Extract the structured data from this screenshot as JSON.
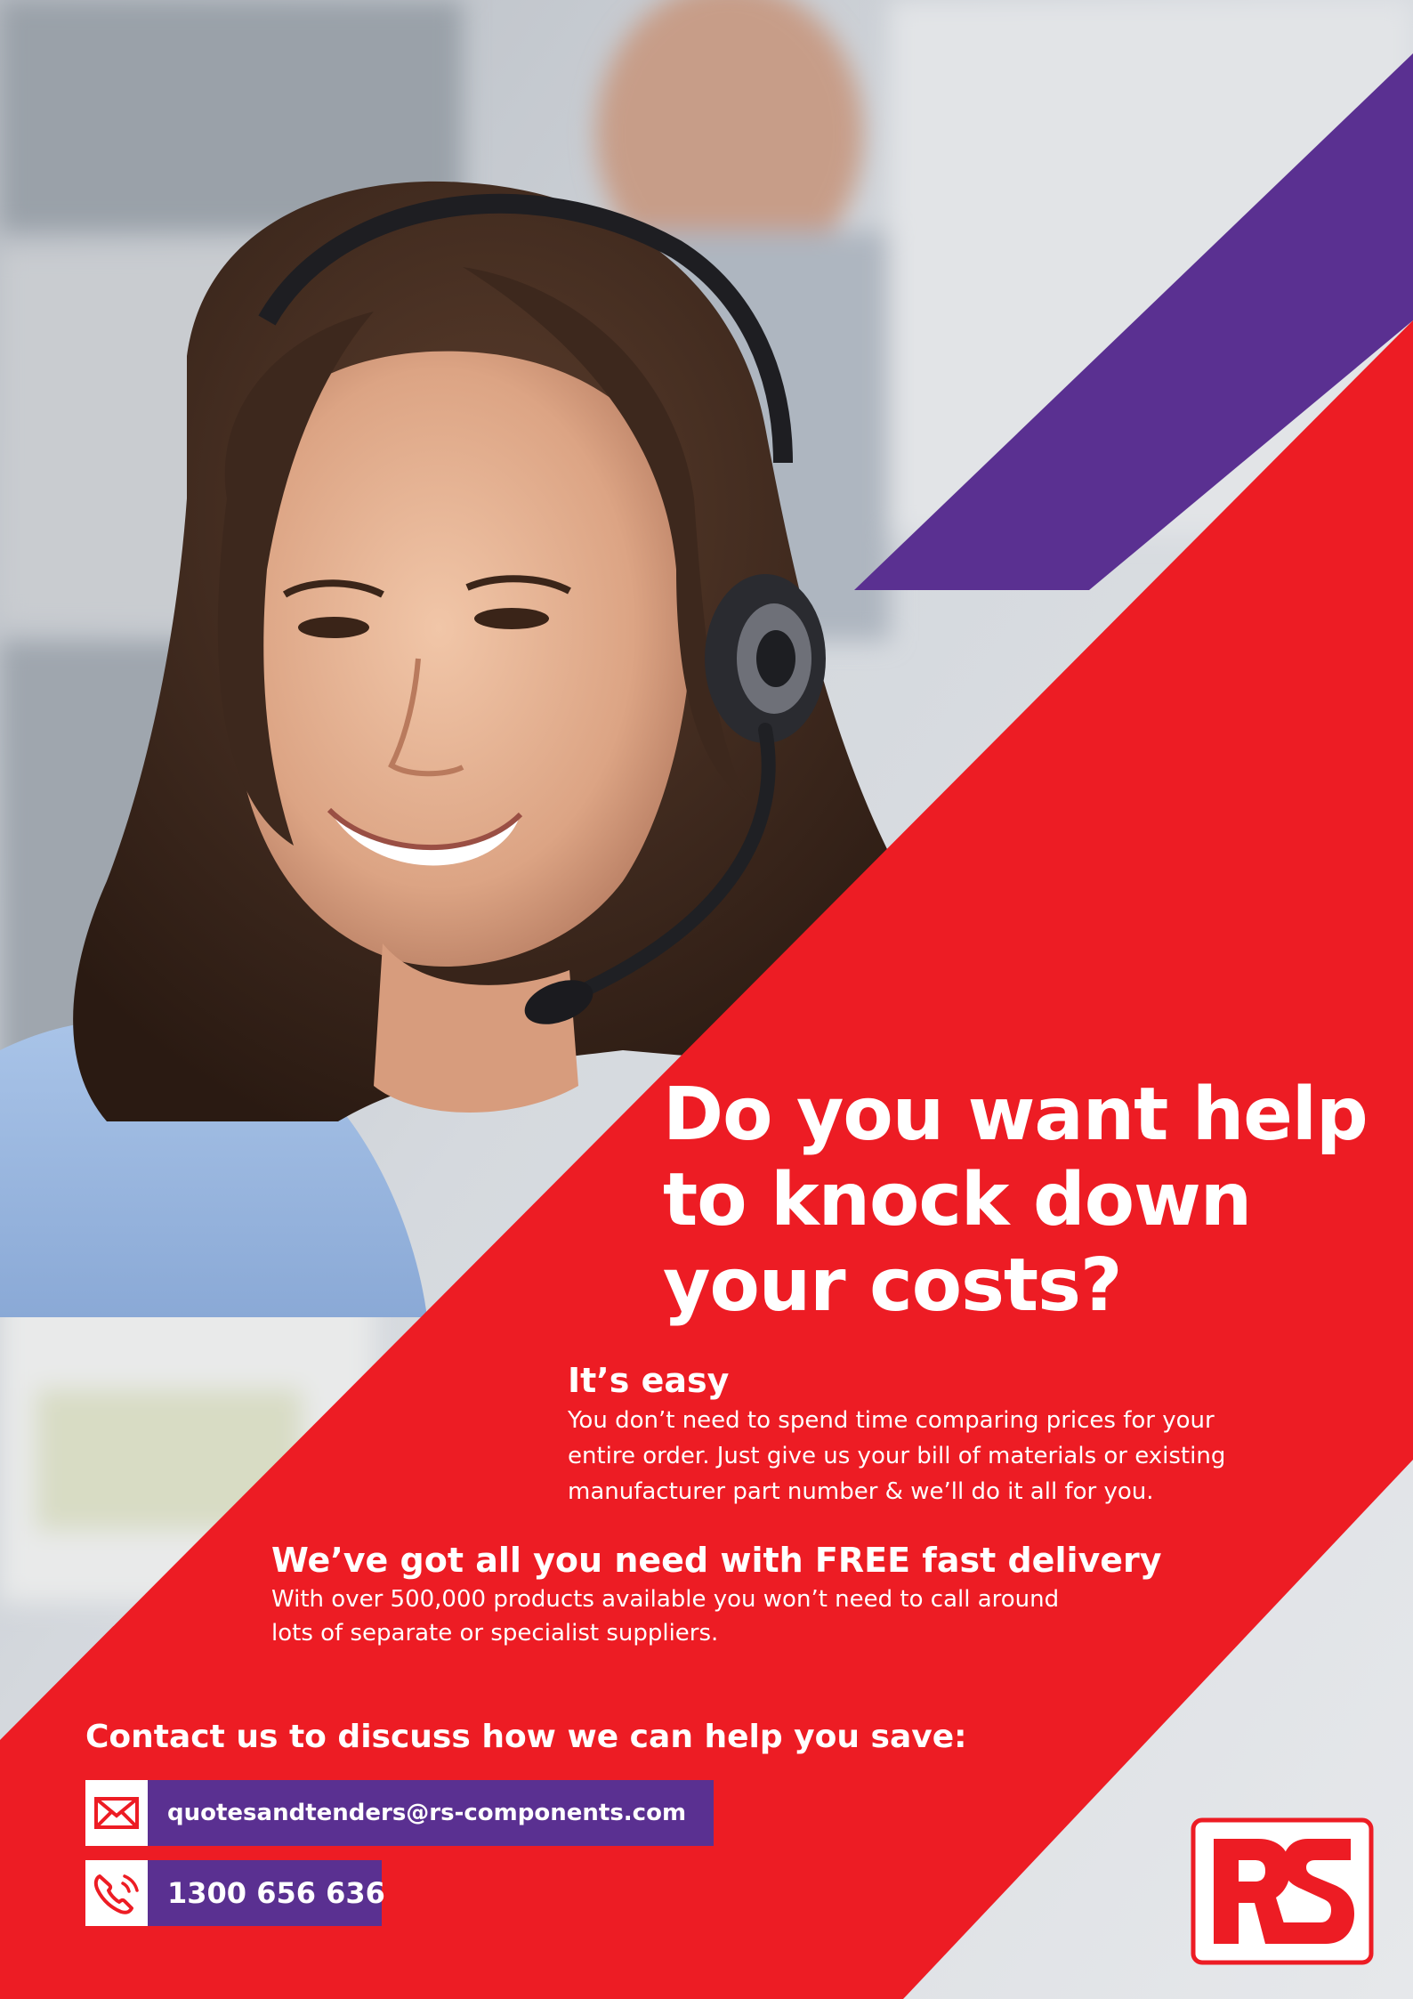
{
  "photo": {
    "description_icon": "customer-service-agent-photo"
  },
  "headline": {
    "lines": [
      "Do you want help",
      "to knock down",
      "your costs?"
    ]
  },
  "easy": {
    "title": "It’s easy",
    "lines": [
      "You don’t need to spend time comparing prices for your",
      "entire order. Just give us your bill of materials or existing",
      "manufacturer part number & we’ll do it all for you."
    ]
  },
  "delivery": {
    "title": "We’ve got all you need with FREE fast delivery",
    "lines": [
      "With over 500,000 products available you won’t need to call around",
      "lots of separate or specialist suppliers."
    ]
  },
  "contact": {
    "heading": "Contact us to discuss how we can help you save:",
    "email": "quotesandtenders@rs-components.com",
    "phone": "1300 656 636",
    "email_icon": "envelope-icon",
    "phone_icon": "phone-icon"
  },
  "logo": {
    "icon": "rs-logo"
  },
  "colors": {
    "red": "#ed1c24",
    "purple": "#5a3091",
    "white": "#ffffff"
  }
}
